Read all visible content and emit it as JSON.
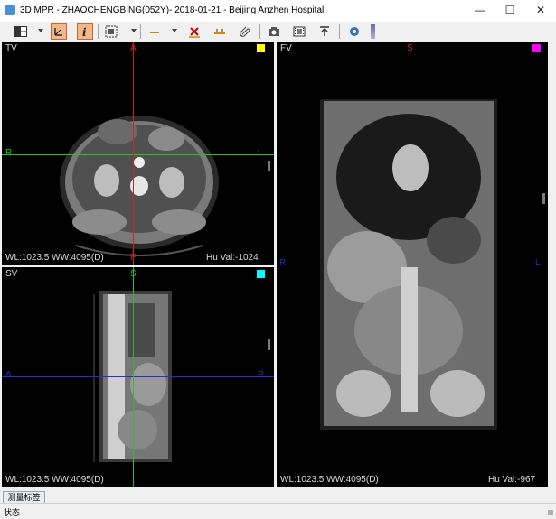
{
  "window": {
    "title": "3D MPR - ZHAOCHENGBING(052Y)- 2018-01-21 - Beijing Anzhen Hospital",
    "controls": {
      "minimize": "—",
      "maximize": "☐",
      "close": "✕"
    }
  },
  "toolbar": {
    "buttons": [
      {
        "name": "layout-icon",
        "active": false
      },
      {
        "name": "crosshair-tool-icon",
        "active": true
      },
      {
        "name": "info-tool-icon",
        "active": true
      },
      {
        "name": "screen-select-icon",
        "active": false
      },
      {
        "name": "measure-line-icon",
        "active": false
      },
      {
        "name": "delete-measure-icon",
        "active": false
      },
      {
        "name": "ruler-icon",
        "active": false
      },
      {
        "name": "attach-icon",
        "active": false
      },
      {
        "name": "camera-icon",
        "active": false
      },
      {
        "name": "film-icon",
        "active": false
      },
      {
        "name": "export-icon",
        "active": false
      },
      {
        "name": "settings-icon",
        "active": false
      }
    ]
  },
  "viewports": {
    "tv": {
      "name": "TV",
      "top": "A",
      "bottom": "P",
      "left": "R",
      "right": "L",
      "wlww": "WL:1023.5 WW:4095(D)",
      "huval": "Hu Val:-1024",
      "corner_color": "#ffff00",
      "h_line_color": "#22c322",
      "v_line_color": "#d12020"
    },
    "sv": {
      "name": "SV",
      "top": "S",
      "left": "A",
      "right": "P",
      "wlww": "WL:1023.5 WW:4095(D)",
      "corner_color": "#00ffff",
      "h_line_color": "#2a2ad8",
      "v_line_color": "#22c322"
    },
    "fv": {
      "name": "FV",
      "top": "S",
      "bottom": "I",
      "left": "R",
      "right": "L",
      "wlww": "WL:1023.5 WW:4095(D)",
      "huval": "Hu Val:-967",
      "corner_color": "#ff00ff",
      "h_line_color": "#2a2ad8",
      "v_line_color": "#d12020"
    }
  },
  "bottom": {
    "tab_label": "测量标签",
    "status_label": "状态"
  }
}
